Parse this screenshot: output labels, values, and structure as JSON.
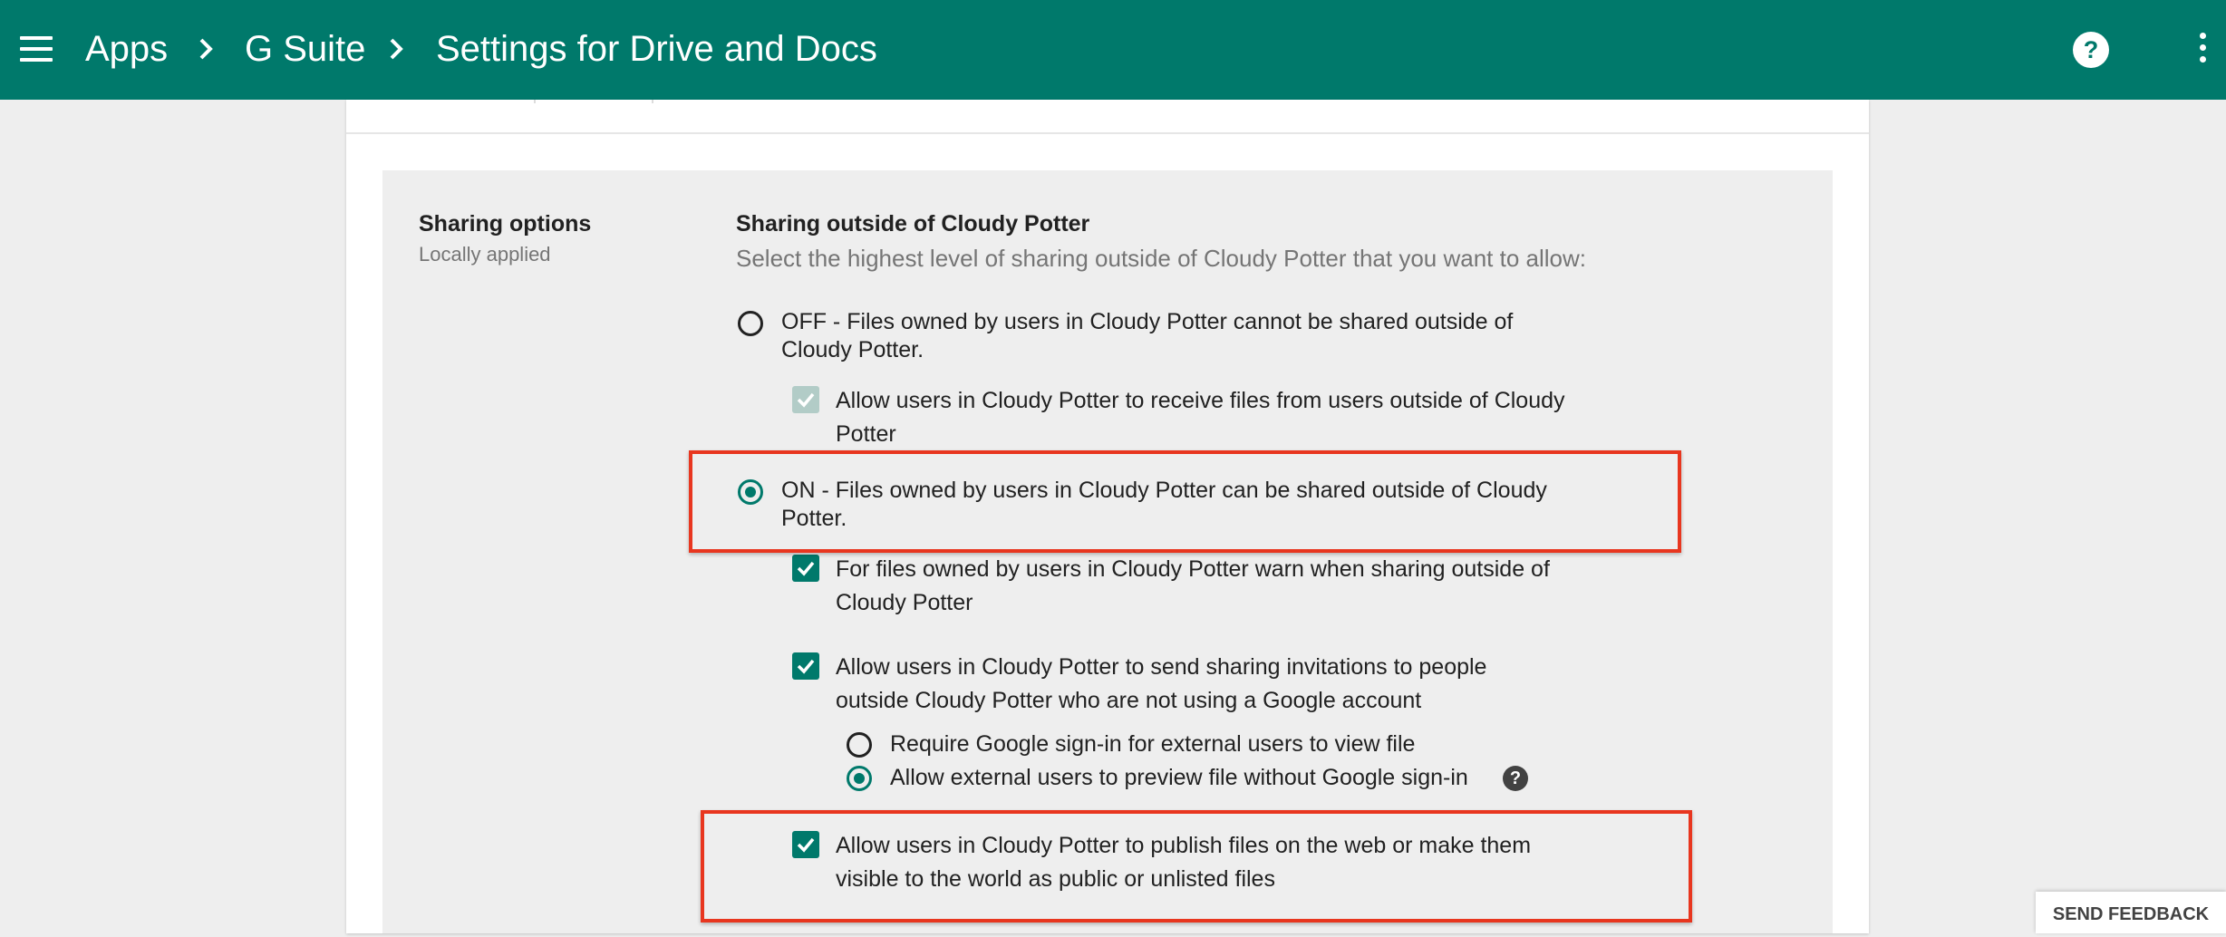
{
  "header": {
    "breadcrumbs": [
      "Apps",
      "G Suite",
      "Settings for Drive and Docs"
    ]
  },
  "section": {
    "title": "Sharing options",
    "subtitle": "Locally applied"
  },
  "sharing": {
    "heading": "Sharing outside of Cloudy Potter",
    "description": "Select the highest level of sharing outside of Cloudy Potter that you want to allow:",
    "off_option": {
      "line1": "OFF - Files owned by users in Cloudy Potter cannot be shared outside of",
      "line2": "Cloudy Potter.",
      "selected": false
    },
    "receive_files": {
      "line1": "Allow users in Cloudy Potter to receive files from users outside of Cloudy",
      "line2": "Potter",
      "checked": true,
      "disabled": true
    },
    "on_option": {
      "line1": "ON - Files owned by users in Cloudy Potter can be shared outside of Cloudy",
      "line2": "Potter.",
      "selected": true
    },
    "warn_sharing": {
      "line1": "For files owned by users in Cloudy Potter warn when sharing outside of",
      "line2": "Cloudy Potter",
      "checked": true
    },
    "send_invitations": {
      "line1": "Allow users in Cloudy Potter to send sharing invitations to people",
      "line2": "outside Cloudy Potter who are not using a Google account",
      "checked": true
    },
    "require_signin": {
      "label": "Require Google sign-in for external users to view file",
      "selected": false
    },
    "preview_without_signin": {
      "label": "Allow external users to preview file without Google sign-in",
      "selected": true
    },
    "publish_files": {
      "line1": "Allow users in Cloudy Potter to publish files on the web or make them",
      "line2": "visible to the world as public or unlisted files",
      "checked": true
    }
  },
  "feedback": {
    "label": "SEND FEEDBACK"
  },
  "icons": {
    "menu": "hamburger-menu-icon",
    "chevron": "chevron-right-icon",
    "help": "help-circle-icon",
    "more": "more-vertical-icon",
    "check": "checkmark-icon",
    "info": "question-mark-icon"
  },
  "colors": {
    "header_bg": "#00796b",
    "accent": "#00796b",
    "highlight": "#e8361f"
  }
}
